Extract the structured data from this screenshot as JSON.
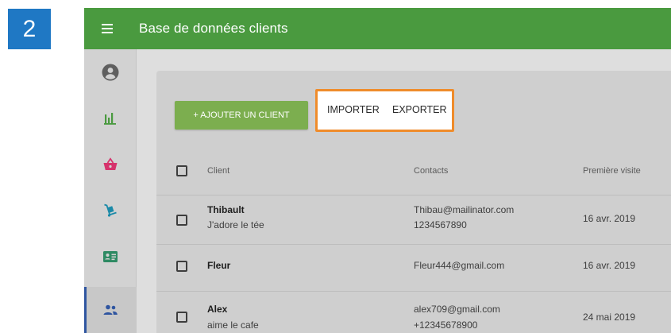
{
  "step_badge": "2",
  "app": {
    "title": "Base de données clients"
  },
  "colors": {
    "header": "#4a9a3f",
    "add_button": "#7cae4f",
    "highlight_border": "#ef8c2b",
    "badge": "#1f78c4"
  },
  "sidebar": {
    "items": [
      {
        "icon": "account-circle-icon",
        "active": false
      },
      {
        "icon": "bar-chart-icon",
        "active": false
      },
      {
        "icon": "shopping-basket-icon",
        "active": false
      },
      {
        "icon": "hand-truck-icon",
        "active": false
      },
      {
        "icon": "contact-card-icon",
        "active": false
      },
      {
        "icon": "people-icon",
        "active": true
      }
    ]
  },
  "toolbar": {
    "add_label": "+ AJOUTER UN CLIENT",
    "import_label": "IMPORTER",
    "export_label": "EXPORTER"
  },
  "table": {
    "headers": {
      "client": "Client",
      "contacts": "Contacts",
      "first_visit": "Première visite"
    },
    "rows": [
      {
        "name": "Thibault",
        "note": "J'adore le tée",
        "email": "Thibau@mailinator.com",
        "phone": "1234567890",
        "date": "16 avr. 2019"
      },
      {
        "name": "Fleur",
        "note": "",
        "email": "Fleur444@gmail.com",
        "phone": "",
        "date": "16 avr. 2019"
      },
      {
        "name": "Alex",
        "note": "aime le cafe",
        "email": "alex709@gmail.com",
        "phone": "+12345678900",
        "date": "24 mai 2019"
      }
    ]
  }
}
